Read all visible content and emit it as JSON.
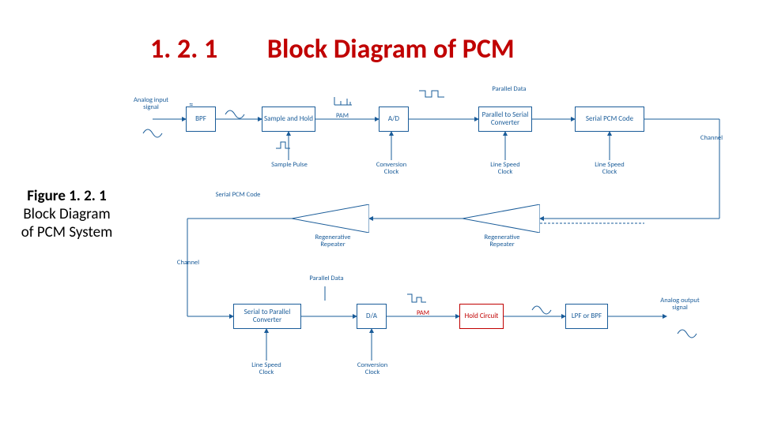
{
  "heading": {
    "number": "1. 2. 1",
    "title": "Block Diagram of PCM"
  },
  "caption": {
    "fignum": "Figure 1. 2. 1",
    "text": "Block Diagram of PCM System"
  },
  "row_tx": {
    "in_label": "Analog input signal",
    "bpf": "BPF",
    "sample_hold": "Sample and Hold",
    "pam": "PAM",
    "ad": "A/D",
    "parallel_data": "Parallel Data",
    "p2s": "Parallel to Serial Converter",
    "serial_code": "Serial PCM Code",
    "sample_pulse": "Sample Pulse",
    "conv_clock": "Conversion Clock",
    "line_clock": "Line Speed Clock",
    "channel": "Channel"
  },
  "row_ch": {
    "serial_code": "Serial PCM Code",
    "rep1": "Regenerative Repeater",
    "rep2": "Regenerative Repeater",
    "channel": "Channel"
  },
  "row_rx": {
    "s2p": "Serial to Parallel Converter",
    "parallel_data": "Parallel Data",
    "da": "D/A",
    "pam": "PAM",
    "hold": "Hold Circuit",
    "lpf": "LPF or BPF",
    "out_label": "Analog output signal",
    "line_clock": "Line Speed Clock",
    "conv_clock": "Conversion Clock"
  }
}
